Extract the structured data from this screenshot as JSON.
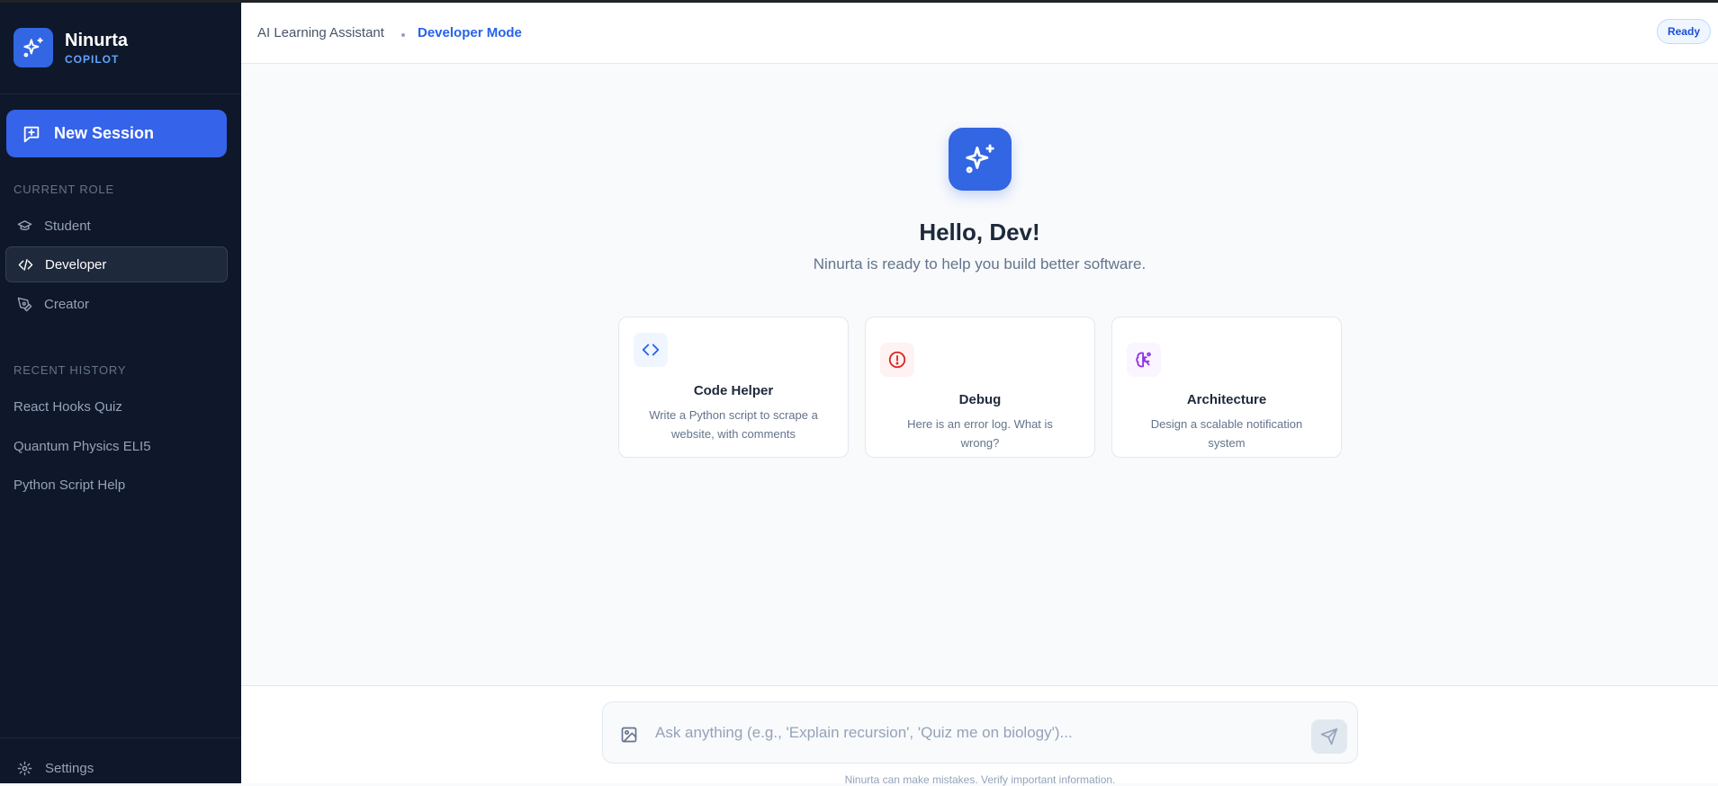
{
  "brand": {
    "name": "Ninurta",
    "subtitle": "COPILOT",
    "logo_icon": "sparkles-icon"
  },
  "sidebar": {
    "new_session_label": "New Session",
    "roles_heading": "CURRENT ROLE",
    "roles": [
      {
        "label": "Student",
        "icon": "graduation-cap-icon",
        "active": false
      },
      {
        "label": "Developer",
        "icon": "code-icon",
        "active": true
      },
      {
        "label": "Creator",
        "icon": "pen-tool-icon",
        "active": false
      }
    ],
    "history_heading": "RECENT HISTORY",
    "history": [
      "React Hooks Quiz",
      "Quantum Physics ELI5",
      "Python Script Help"
    ],
    "settings_label": "Settings"
  },
  "header": {
    "breadcrumb_app": "AI Learning Assistant",
    "breadcrumb_mode": "Developer Mode",
    "status": "Ready"
  },
  "welcome": {
    "title": "Hello, Dev!",
    "subtitle": "Ninurta is ready to help you build better software."
  },
  "cards": [
    {
      "title": "Code Helper",
      "description": "Write a Python script to scrape a website, with comments",
      "icon": "code-icon",
      "color": "#2563eb"
    },
    {
      "title": "Debug",
      "description": "Here is an error log. What is wrong?",
      "icon": "alert-circle-icon",
      "color": "#dc2626"
    },
    {
      "title": "Architecture",
      "description": "Design a scalable notification system",
      "icon": "brain-icon",
      "color": "#9333ea"
    }
  ],
  "composer": {
    "placeholder": "Ask anything (e.g., 'Explain recursion', 'Quiz me on biology')...",
    "value": "",
    "disclaimer": "Ninurta can make mistakes. Verify important information."
  },
  "colors": {
    "accent": "#3266e3",
    "sidebar_bg": "#0f172a",
    "main_bg": "#f8fafc"
  }
}
